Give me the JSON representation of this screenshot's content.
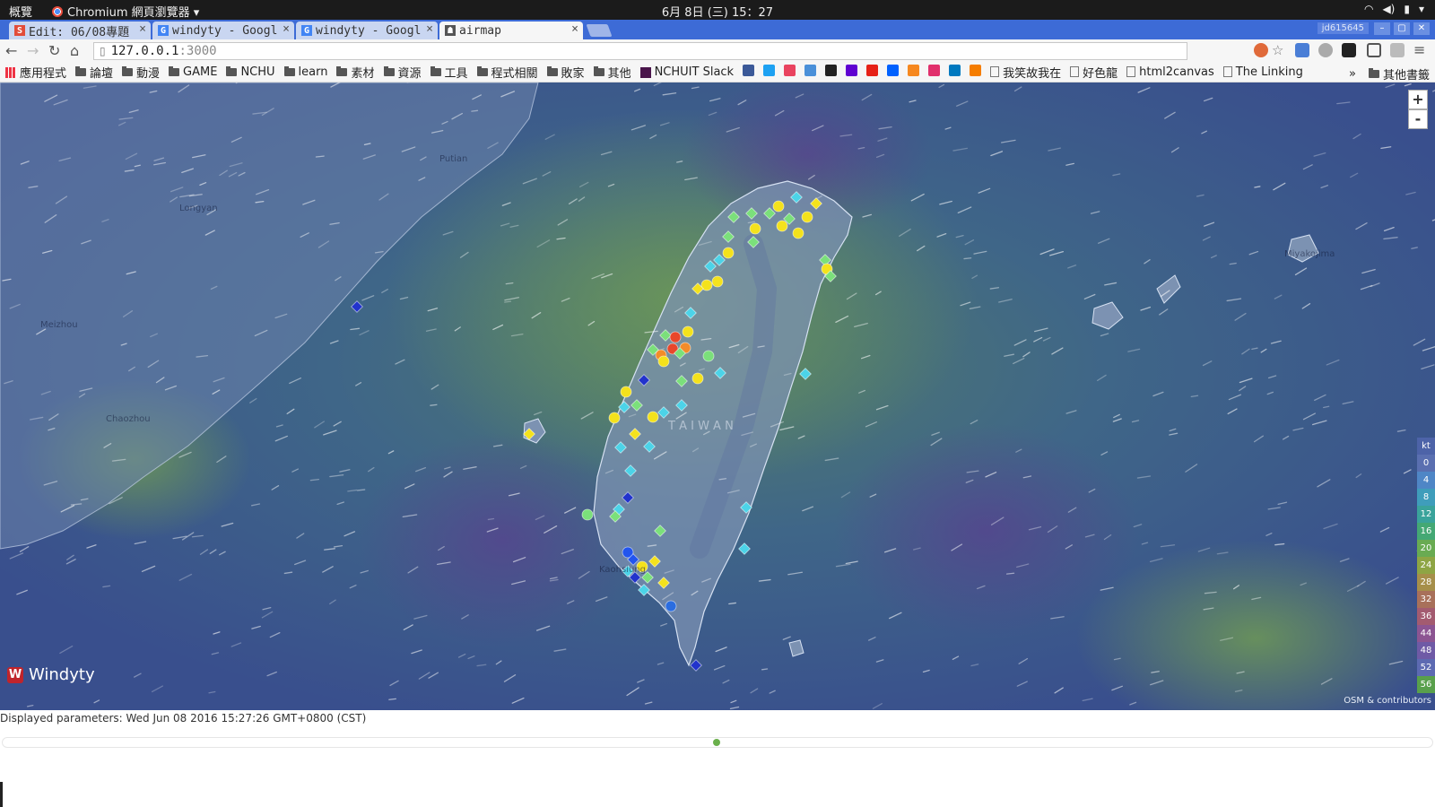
{
  "os": {
    "overview_label": "概覽",
    "app_label": "Chromium 網頁瀏覽器 ▾",
    "clock": "6月 8日 (三) 15：27"
  },
  "tabs": [
    {
      "label": "Edit: 06/08專題",
      "favicon": "S",
      "color": "#e24c3a"
    },
    {
      "label": "windyty - Googl",
      "favicon": "G",
      "color": "#4285f4"
    },
    {
      "label": "windyty - Googl",
      "favicon": "G",
      "color": "#4285f4"
    },
    {
      "label": "airmap",
      "favicon": "☗",
      "color": "#555555"
    }
  ],
  "profile_name": "jd615645",
  "address": {
    "host": "127.0.0.1",
    "port": ":3000"
  },
  "bookmarks": {
    "apps": "應用程式",
    "folders": [
      "論壇",
      "動漫",
      "GAME",
      "NCHU",
      "learn",
      "素材",
      "資源",
      "工具",
      "程式相關",
      "敗家",
      "其他"
    ],
    "slack": "NCHUIT Slack",
    "icons": [
      "#3b5998",
      "#1da1f2",
      "#e9435f",
      "#4a90d9",
      "#222222",
      "#5f01d1",
      "#e62117",
      "#0061fe",
      "#f6881f",
      "#e1306c",
      "#0079bf",
      "#f57d00"
    ],
    "links": [
      "我笑故我在",
      "好色龍",
      "html2canvas",
      "The Linking"
    ],
    "overflow": "»",
    "other": "其他書籤"
  },
  "map": {
    "zoom_in": "+",
    "zoom_out": "-",
    "brand": "Windyty",
    "attribution": "OSM & contributors",
    "island_label": "T A I W A N",
    "place_labels": [
      "Longyan",
      "Putian",
      "Meizhou",
      "Chaozhou",
      "Kaohsiung",
      "Miyakojima"
    ],
    "legend_unit": "kt",
    "legend_values": [
      "0",
      "4",
      "8",
      "12",
      "16",
      "20",
      "24",
      "28",
      "32",
      "36",
      "44",
      "48",
      "52",
      "56"
    ],
    "legend_colors": [
      "#5a6fb0",
      "#4f86c6",
      "#3f9dbb",
      "#3aa39b",
      "#44a874",
      "#69ab52",
      "#8ea544",
      "#a68f4a",
      "#a8705a",
      "#a35b70",
      "#8c5592",
      "#6f5aa6",
      "#5d6ab2",
      "#59a04c"
    ]
  },
  "status_text": "Displayed parameters: Wed Jun 08 2016 15:27:26 GMT+0800 (CST)"
}
